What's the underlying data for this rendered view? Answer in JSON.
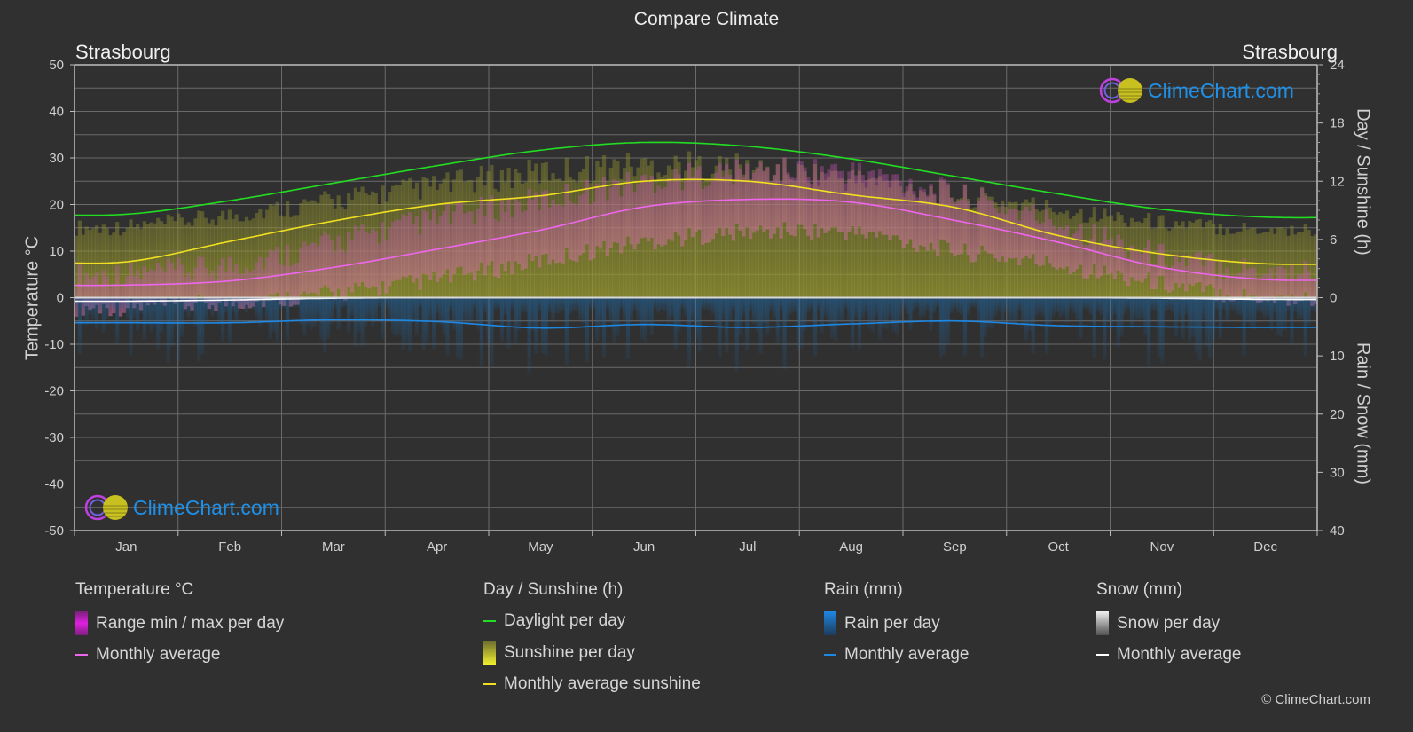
{
  "title": "Compare Climate",
  "location_left": "Strasbourg",
  "location_right": "Strasbourg",
  "watermark": "ClimeChart.com",
  "copyright": "© ClimeChart.com",
  "colors": {
    "background": "#303030",
    "grid": "#6a6a6a",
    "daylight": "#22dd22",
    "sunshine_avg": "#f0e020",
    "temp_avg": "#ee66ee",
    "rain_avg": "#1e88e5",
    "snow_avg": "#ffffff",
    "temp_range": "#d040c0",
    "sunshine_fill": "#9a9a30",
    "rain_fill": "#1e5a8a",
    "snow_fill": "#8a8a8a",
    "logo_text": "#1e90e8"
  },
  "legend": {
    "groups": [
      {
        "heading": "Temperature °C",
        "items": [
          {
            "label": "Range min / max per day",
            "swatch": "box",
            "color": "#e020e0"
          },
          {
            "label": "Monthly average",
            "swatch": "line",
            "color": "#ee66ee"
          }
        ]
      },
      {
        "heading": "Day / Sunshine (h)",
        "items": [
          {
            "label": "Daylight per day",
            "swatch": "line",
            "color": "#22dd22"
          },
          {
            "label": "Sunshine per day",
            "swatch": "box",
            "color": "#e8e830"
          },
          {
            "label": "Monthly average sunshine",
            "swatch": "line",
            "color": "#f0e020"
          }
        ]
      },
      {
        "heading": "Rain (mm)",
        "items": [
          {
            "label": "Rain per day",
            "swatch": "box",
            "color": "#1e88e5"
          },
          {
            "label": "Monthly average",
            "swatch": "line",
            "color": "#1e88e5"
          }
        ]
      },
      {
        "heading": "Snow (mm)",
        "items": [
          {
            "label": "Snow per day",
            "swatch": "box",
            "color": "#e0e0e0"
          },
          {
            "label": "Monthly average",
            "swatch": "line",
            "color": "#ffffff"
          }
        ]
      }
    ]
  },
  "chart_data": {
    "type": "line",
    "title": "Compare Climate",
    "categories": [
      "Jan",
      "Feb",
      "Mar",
      "Apr",
      "May",
      "Jun",
      "Jul",
      "Aug",
      "Sep",
      "Oct",
      "Nov",
      "Dec"
    ],
    "y_left": {
      "label": "Temperature °C",
      "range": [
        -50,
        50
      ],
      "ticks": [
        50,
        40,
        30,
        20,
        10,
        0,
        -10,
        -20,
        -30,
        -40,
        -50
      ]
    },
    "y_right_top": {
      "label": "Day / Sunshine (h)",
      "range": [
        0,
        24
      ],
      "ticks": [
        24,
        18,
        12,
        6,
        0
      ]
    },
    "y_right_bottom": {
      "label": "Rain / Snow (mm)",
      "range": [
        0,
        40
      ],
      "ticks": [
        0,
        10,
        20,
        30,
        40
      ]
    },
    "grid": true,
    "legend_position": "bottom",
    "series": [
      {
        "name": "Daylight per day",
        "axis": "sunshine_h",
        "values": [
          8.6,
          10.0,
          11.8,
          13.6,
          15.2,
          16.0,
          15.6,
          14.3,
          12.5,
          10.7,
          9.1,
          8.3
        ]
      },
      {
        "name": "Monthly average sunshine",
        "axis": "sunshine_h",
        "values": [
          3.7,
          5.8,
          7.9,
          9.6,
          10.5,
          12.0,
          12.0,
          10.6,
          9.3,
          6.4,
          4.5,
          3.5
        ]
      },
      {
        "name": "Temperature monthly average",
        "axis": "temperature_c",
        "values": [
          2.7,
          3.6,
          6.5,
          10.4,
          14.5,
          19.5,
          21.1,
          20.5,
          16.6,
          11.9,
          6.5,
          3.9
        ]
      },
      {
        "name": "Rain monthly average",
        "axis": "rain_mm",
        "values": [
          4.3,
          4.3,
          3.8,
          4.1,
          5.2,
          4.6,
          5.1,
          4.5,
          4.0,
          4.8,
          5.0,
          5.1
        ]
      },
      {
        "name": "Snow monthly average",
        "axis": "snow_mm",
        "values": [
          0.6,
          0.4,
          0.1,
          0.0,
          0.0,
          0.0,
          0.0,
          0.0,
          0.0,
          0.0,
          0.1,
          0.3
        ]
      },
      {
        "name": "Temperature daily max (approx)",
        "axis": "temperature_c",
        "values": [
          5,
          7,
          12,
          17,
          21,
          25,
          27,
          27,
          22,
          16,
          9,
          6
        ]
      },
      {
        "name": "Temperature daily min (approx)",
        "axis": "temperature_c",
        "values": [
          -2,
          -1,
          1,
          4,
          8,
          12,
          14,
          14,
          10,
          7,
          3,
          0
        ]
      }
    ]
  }
}
